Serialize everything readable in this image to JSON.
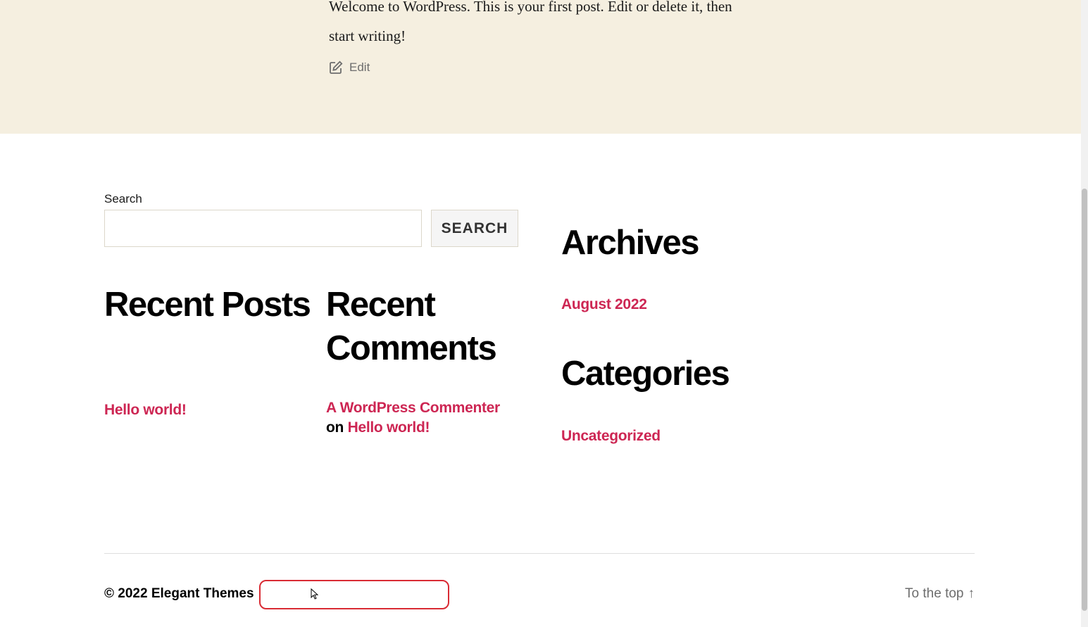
{
  "post": {
    "text": "Welcome to WordPress. This is your first post. Edit or delete it, then start writing!",
    "edit_label": "Edit"
  },
  "search": {
    "label": "Search",
    "value": "",
    "button_label": "SEARCH"
  },
  "widgets": {
    "recent_posts": {
      "title": "Recent Posts",
      "items": [
        "Hello world!"
      ]
    },
    "recent_comments": {
      "title": "Recent Comments",
      "items": [
        {
          "author": "A WordPress Commenter",
          "connector": "on",
          "post": "Hello world!"
        }
      ]
    },
    "archives": {
      "title": "Archives",
      "items": [
        "August 2022"
      ]
    },
    "categories": {
      "title": "Categories",
      "items": [
        "Uncategorized"
      ]
    }
  },
  "footer": {
    "copyright": "© 2022 Elegant Themes",
    "to_top_label": "To the top",
    "to_top_arrow": "↑"
  },
  "colors": {
    "accent": "#cd2653",
    "post_background": "#f5efe0",
    "highlight": "#d92b34"
  },
  "icons": {
    "edit": "edit-icon",
    "arrow_up": "arrow-up-icon",
    "cursor": "mouse-cursor-icon"
  }
}
